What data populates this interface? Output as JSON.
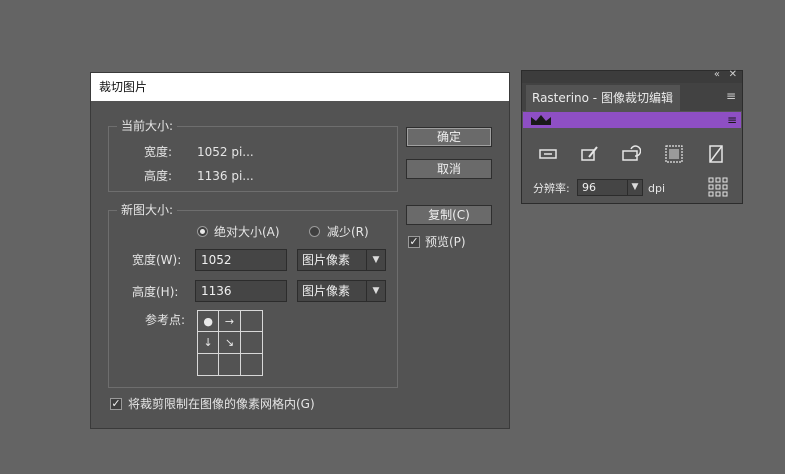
{
  "dialog": {
    "title": "裁切图片",
    "current_size": {
      "legend": "当前大小:",
      "width_label": "宽度:",
      "width_value": "1052 pi...",
      "height_label": "高度:",
      "height_value": "1136 pi..."
    },
    "new_size": {
      "legend": "新图大小:",
      "radio_absolute": "绝对大小(A)",
      "radio_absolute_selected": true,
      "radio_reduce": "减少(R)",
      "width_label": "宽度(W):",
      "width_value": "1052",
      "width_unit": "图片像素",
      "height_label": "高度(H):",
      "height_value": "1136",
      "height_unit": "图片像素",
      "anchor_label": "参考点:"
    },
    "constrain_checkbox": "将裁剪限制在图像的像素网格内(G)",
    "constrain_checked": true,
    "ok_button": "确定",
    "cancel_button": "取消",
    "copy_button": "复制(C)",
    "preview_checkbox": "预览(P)",
    "preview_checked": true
  },
  "panel": {
    "tab_title": "Rasterino - 图像裁切编辑",
    "resolution_label": "分辨率:",
    "resolution_value": "96",
    "resolution_unit": "dpi",
    "accent_color": "#8e4fc4"
  }
}
